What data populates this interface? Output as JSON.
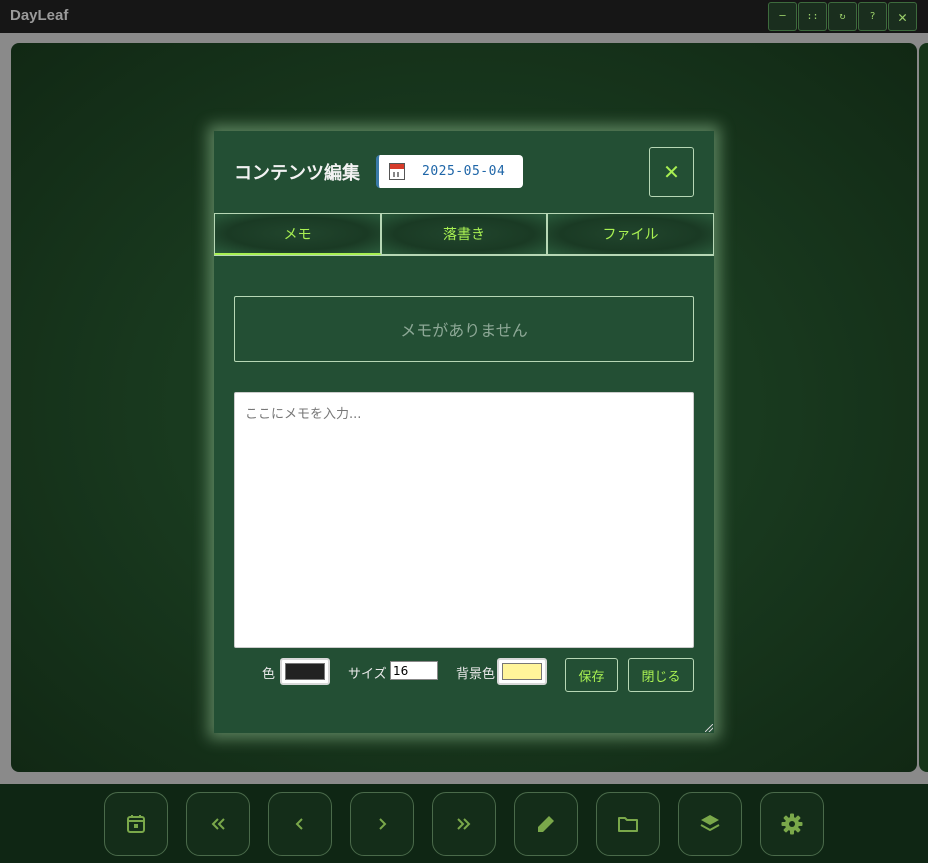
{
  "app": {
    "title": "DayLeaf",
    "window_controls": [
      {
        "name": "minimize-button",
        "glyph": "─"
      },
      {
        "name": "fullscreen-button",
        "glyph": "::"
      },
      {
        "name": "reload-button",
        "glyph": "↻"
      },
      {
        "name": "help-button",
        "glyph": "?"
      },
      {
        "name": "close-window-button",
        "glyph": "✕"
      }
    ]
  },
  "dialog": {
    "title": "コンテンツ編集",
    "date": "2025-05-04",
    "close_glyph": "✕",
    "tabs": [
      {
        "label": "メモ",
        "active": true
      },
      {
        "label": "落書き",
        "active": false
      },
      {
        "label": "ファイル",
        "active": false
      }
    ],
    "empty_message": "メモがありません",
    "memo_placeholder": "ここにメモを入力...",
    "memo_value": "",
    "color_label": "色",
    "color_value": "#222222",
    "size_label": "サイズ",
    "size_value": "16",
    "bg_color_label": "背景色",
    "bg_color_value": "#fff59a",
    "save_label": "保存",
    "close_label": "閉じる"
  },
  "toolbar": {
    "buttons": [
      {
        "name": "calendar-icon"
      },
      {
        "name": "double-chevron-left-icon"
      },
      {
        "name": "chevron-left-icon"
      },
      {
        "name": "chevron-right-icon"
      },
      {
        "name": "double-chevron-right-icon"
      },
      {
        "name": "pencil-icon"
      },
      {
        "name": "folder-icon"
      },
      {
        "name": "layers-icon"
      },
      {
        "name": "gear-icon"
      }
    ]
  },
  "colors": {
    "accent": "#a8f052",
    "dialog_bg": "#234f34",
    "toolbar_icon": "#7aa84a",
    "date_text": "#1f66a8"
  }
}
